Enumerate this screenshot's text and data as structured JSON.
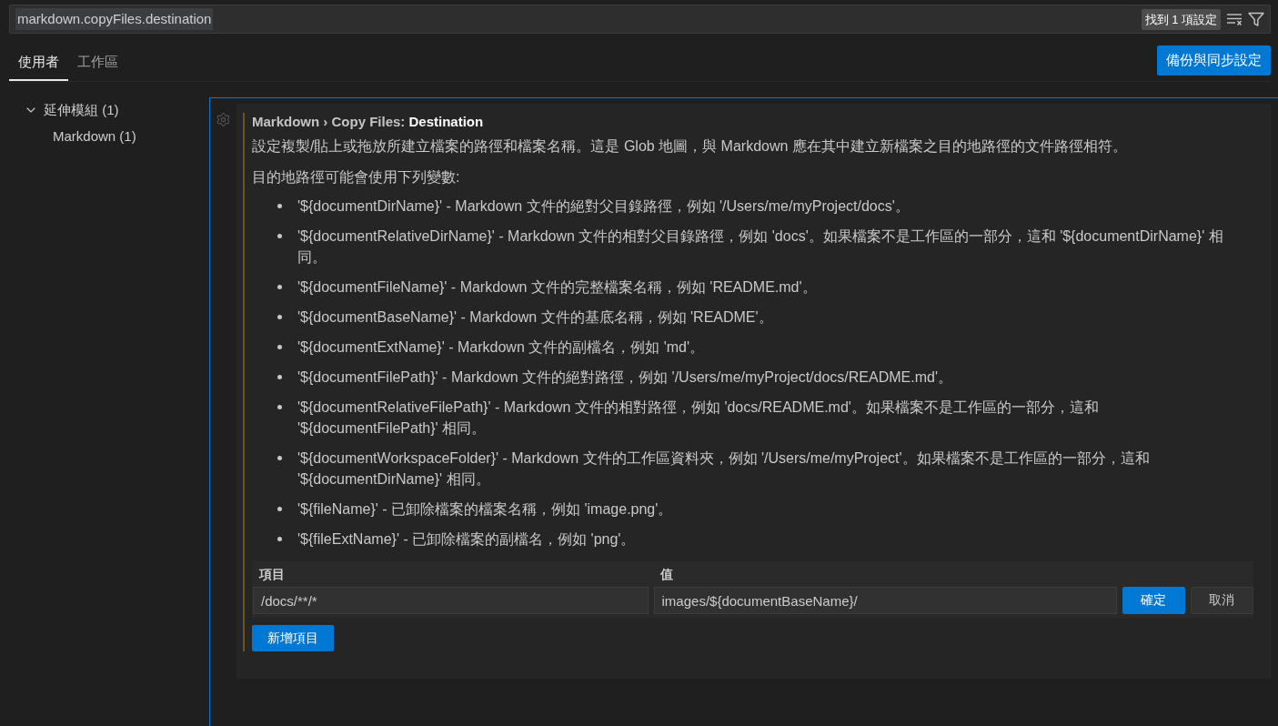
{
  "search": {
    "value": "markdown.copyFiles.destination",
    "text_selected": true,
    "result_count": "找到 1 項設定"
  },
  "tabs": [
    {
      "label": "使用者",
      "selected": true
    },
    {
      "label": "工作區",
      "selected": false
    }
  ],
  "sync_button": "備份與同步設定",
  "tree": [
    {
      "label": "延伸模組 (1)",
      "expanded": true,
      "children": [
        {
          "label": "Markdown (1)"
        }
      ]
    }
  ],
  "setting": {
    "title": "Markdown › Copy Files: **Destination**",
    "modified": true,
    "description": "設定複製/貼上或拖放所建立檔案的路徑和檔案名稱。這是 Glob 地圖，與 Markdown 應在其中建立新檔案之目的地路徑的文件路徑相符。",
    "variables_intro": "目的地路徑可能會使用下列變數:",
    "variables": [
      "'${documentDirName}' - Markdown 文件的絕對父目錄路徑，例如 '/Users/me/myProject/docs'。",
      "'${documentRelativeDirName}' - Markdown 文件的相對父目錄路徑，例如 'docs'。如果檔案不是工作區的一部分，這和 '${documentDirName}' 相同。",
      "'${documentFileName}' - Markdown 文件的完整檔案名稱，例如 'README.md'。",
      "'${documentBaseName}' - Markdown 文件的基底名稱，例如 'README'。",
      "'${documentExtName}' - Markdown 文件的副檔名，例如 'md'。",
      "'${documentFilePath}' - Markdown 文件的絕對路徑，例如 '/Users/me/myProject/docs/README.md'。",
      "'${documentRelativeFilePath}' - Markdown 文件的相對路徑，例如 'docs/README.md'。如果檔案不是工作區的一部分，這和 '${documentFilePath}' 相同。",
      "'${documentWorkspaceFolder}' - Markdown 文件的工作區資料夾，例如 '/Users/me/myProject'。如果檔案不是工作區的一部分，這和 '${documentDirName}' 相同。",
      "'${fileName}' - 已卸除檔案的檔案名稱，例如 'image.png'。",
      "'${fileExtName}' - 已卸除檔案的副檔名，例如 'png'。"
    ],
    "editor": {
      "columns": [
        "項目",
        "值"
      ],
      "key": "/docs/**/*",
      "value": "images/${documentBaseName}/",
      "buttons": [
        {
          "label": "確定",
          "kind": "primary"
        },
        {
          "label": "取消",
          "kind": "secondary"
        }
      ]
    },
    "add_button": "新增項目"
  }
}
